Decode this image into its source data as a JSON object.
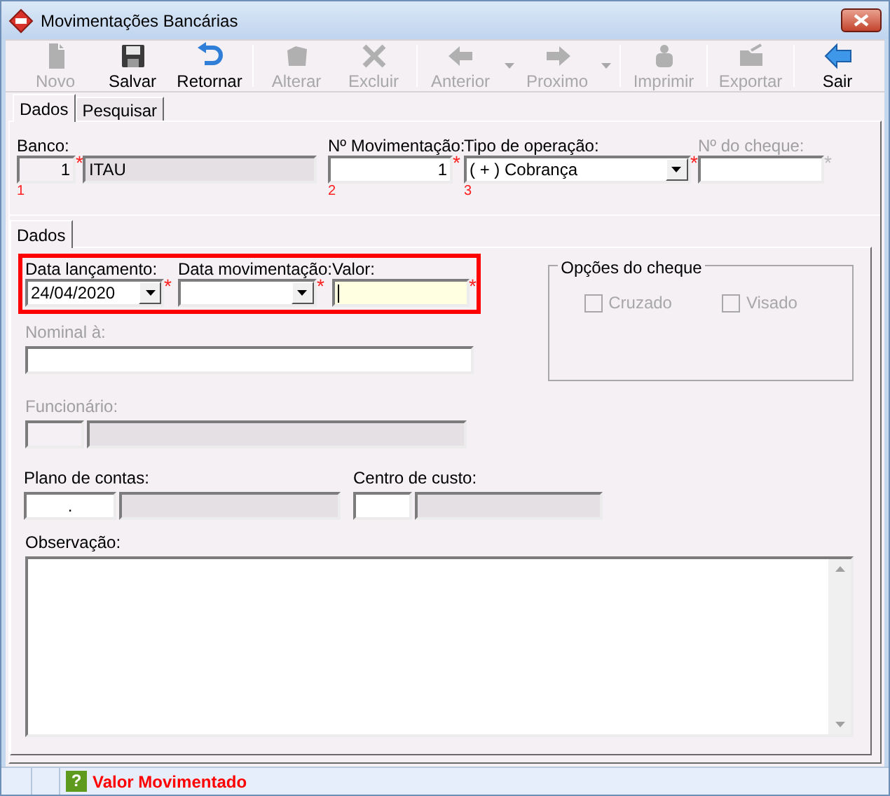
{
  "window": {
    "title": "Movimentações Bancárias"
  },
  "toolbar": [
    [
      {
        "label": "Novo",
        "kind": "new",
        "disabled": true,
        "dropdown": false
      },
      {
        "label": "Salvar",
        "kind": "save",
        "disabled": false,
        "dropdown": false
      },
      {
        "label": "Retornar",
        "kind": "undo",
        "disabled": false,
        "dropdown": false
      }
    ],
    [
      {
        "label": "Alterar",
        "kind": "edit",
        "disabled": true,
        "dropdown": false
      },
      {
        "label": "Excluir",
        "kind": "delete",
        "disabled": true,
        "dropdown": false
      }
    ],
    [
      {
        "label": "Anterior",
        "kind": "back",
        "disabled": true,
        "dropdown": true
      },
      {
        "label": "Proximo",
        "kind": "forward",
        "disabled": true,
        "dropdown": true
      }
    ],
    [
      {
        "label": "Imprimir",
        "kind": "print",
        "disabled": true,
        "dropdown": false
      }
    ],
    [
      {
        "label": "Exportar",
        "kind": "export",
        "disabled": true,
        "dropdown": false
      }
    ],
    [
      {
        "label": "Sair",
        "kind": "exit",
        "disabled": false,
        "dropdown": false
      }
    ]
  ],
  "tabs": [
    {
      "label": "Dados",
      "selected": true
    },
    {
      "label": "Pesquisar",
      "selected": false
    }
  ],
  "banco": {
    "label": "Banco:",
    "code": "1",
    "name": "ITAU",
    "required_mark": "*",
    "order": "1"
  },
  "movimentacao": {
    "label": "Nº Movimentação:",
    "value": "1",
    "required_mark": "*",
    "order": "2"
  },
  "tipo_operacao": {
    "label": "Tipo de operação:",
    "value": "( + ) Cobrança",
    "required_mark": "*",
    "order": "3"
  },
  "cheque_numero": {
    "label": "Nº do cheque:",
    "required_mark": "*",
    "disabled": true
  },
  "inner_tabs": [
    {
      "label": "Dados",
      "selected": true
    }
  ],
  "data_lancamento": {
    "label": "Data lançamento:",
    "value": "24/04/2020",
    "required_mark": "*"
  },
  "data_movimentacao": {
    "label": "Data movimentação:",
    "required_mark": "*"
  },
  "valor": {
    "label": "Valor:",
    "required_mark": "*",
    "focused": true
  },
  "opcoes_cheque": {
    "title": "Opções do cheque",
    "options": [
      {
        "label": "Cruzado",
        "checked": false,
        "disabled": true
      },
      {
        "label": "Visado",
        "checked": false,
        "disabled": true
      }
    ]
  },
  "nominal": {
    "label": "Nominal à:",
    "disabled": true
  },
  "funcionario": {
    "label": "Funcionário:",
    "disabled": true
  },
  "plano_contas": {
    "label": "Plano de contas:",
    "code": "."
  },
  "centro_custo": {
    "label": "Centro de custo:"
  },
  "observacao": {
    "label": "Observação:"
  },
  "status_bar": {
    "icon_glyph": "?",
    "message": "Valor Movimentado"
  }
}
